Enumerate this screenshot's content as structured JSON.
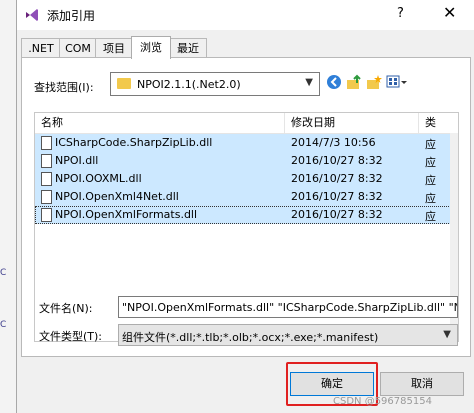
{
  "window": {
    "title": "添加引用",
    "help_label": "?",
    "close_label": "✕"
  },
  "tabs": [
    {
      "label": ".NET"
    },
    {
      "label": "COM"
    },
    {
      "label": "项目"
    },
    {
      "label": "浏览",
      "selected": true
    },
    {
      "label": "最近"
    }
  ],
  "lookin": {
    "label": "查找范围(I):",
    "value": "NPOI2.1.1(.Net2.0)"
  },
  "toolbar": {
    "back_icon": "back-icon",
    "up_icon": "up-folder-icon",
    "new_folder_icon": "new-folder-icon",
    "views_icon": "views-menu-icon"
  },
  "list": {
    "columns": {
      "name": "名称",
      "modified": "修改日期",
      "type": "类"
    },
    "rows": [
      {
        "name": "ICSharpCode.SharpZipLib.dll",
        "modified": "2014/7/3 10:56",
        "type": "应"
      },
      {
        "name": "NPOI.dll",
        "modified": "2016/10/27 8:32",
        "type": "应"
      },
      {
        "name": "NPOI.OOXML.dll",
        "modified": "2016/10/27 8:32",
        "type": "应"
      },
      {
        "name": "NPOI.OpenXml4Net.dll",
        "modified": "2016/10/27 8:32",
        "type": "应"
      },
      {
        "name": "NPOI.OpenXmlFormats.dll",
        "modified": "2016/10/27 8:32",
        "type": "应"
      }
    ]
  },
  "filename": {
    "label": "文件名(N):",
    "value": "\"NPOI.OpenXmlFormats.dll\" \"ICSharpCode.SharpZipLib.dll\" \"NP"
  },
  "filetype": {
    "label": "文件类型(T):",
    "value": "组件文件(*.dll;*.tlb;*.olb;*.ocx;*.exe;*.manifest)"
  },
  "buttons": {
    "ok": "确定",
    "cancel": "取消"
  },
  "watermark": "CSDN @596785154",
  "colors": {
    "selection": "#cce8ff",
    "highlight_box": "#e02020",
    "default_button_border": "#0078d7"
  }
}
